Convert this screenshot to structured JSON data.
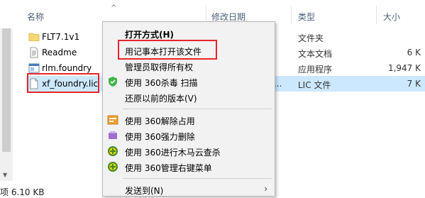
{
  "columns": {
    "name": "名称",
    "date": "修改日期",
    "type": "类型",
    "size": "大小"
  },
  "files": [
    {
      "name": "FLT7.1v1",
      "type": "文件夹",
      "size": "",
      "icon": "folder-icon"
    },
    {
      "name": "Readme",
      "type": "文本文档",
      "size": "6 K",
      "icon": "text-document-icon"
    },
    {
      "name": "rlm.foundry",
      "type": "应用程序",
      "size": "1,947 K",
      "icon": "application-icon"
    },
    {
      "name": "xf_foundry.lic",
      "type": "LIC 文件",
      "size": "7 K",
      "icon": "document-icon",
      "date_partial": "..."
    }
  ],
  "status": {
    "left_text": "项 6.10 KB"
  },
  "context_menu": {
    "items": [
      {
        "label": "打开方式(H)",
        "bold": true,
        "icon": ""
      },
      {
        "label": "用记事本打开该文件",
        "icon": ""
      },
      {
        "label": "管理员取得所有权",
        "icon": ""
      },
      {
        "label": "使用 360杀毒 扫描",
        "icon": "360-antivirus-icon"
      },
      {
        "label": "还原以前的版本(V)",
        "icon": ""
      },
      {
        "label": "使用 360解除占用",
        "icon": "360-unlock-icon"
      },
      {
        "label": "使用 360强力删除",
        "icon": "360-delete-icon"
      },
      {
        "label": "使用 360进行木马云查杀",
        "icon": "360-trojan-scan-icon"
      },
      {
        "label": "使用 360管理右键菜单",
        "icon": "360-menu-manager-icon"
      },
      {
        "label": "发送到(N)",
        "icon": "",
        "submenu": true
      }
    ]
  },
  "colors": {
    "selection": "#cce8ff",
    "highlight_border": "#e8262c",
    "menu_bg": "#f2f2f2"
  }
}
